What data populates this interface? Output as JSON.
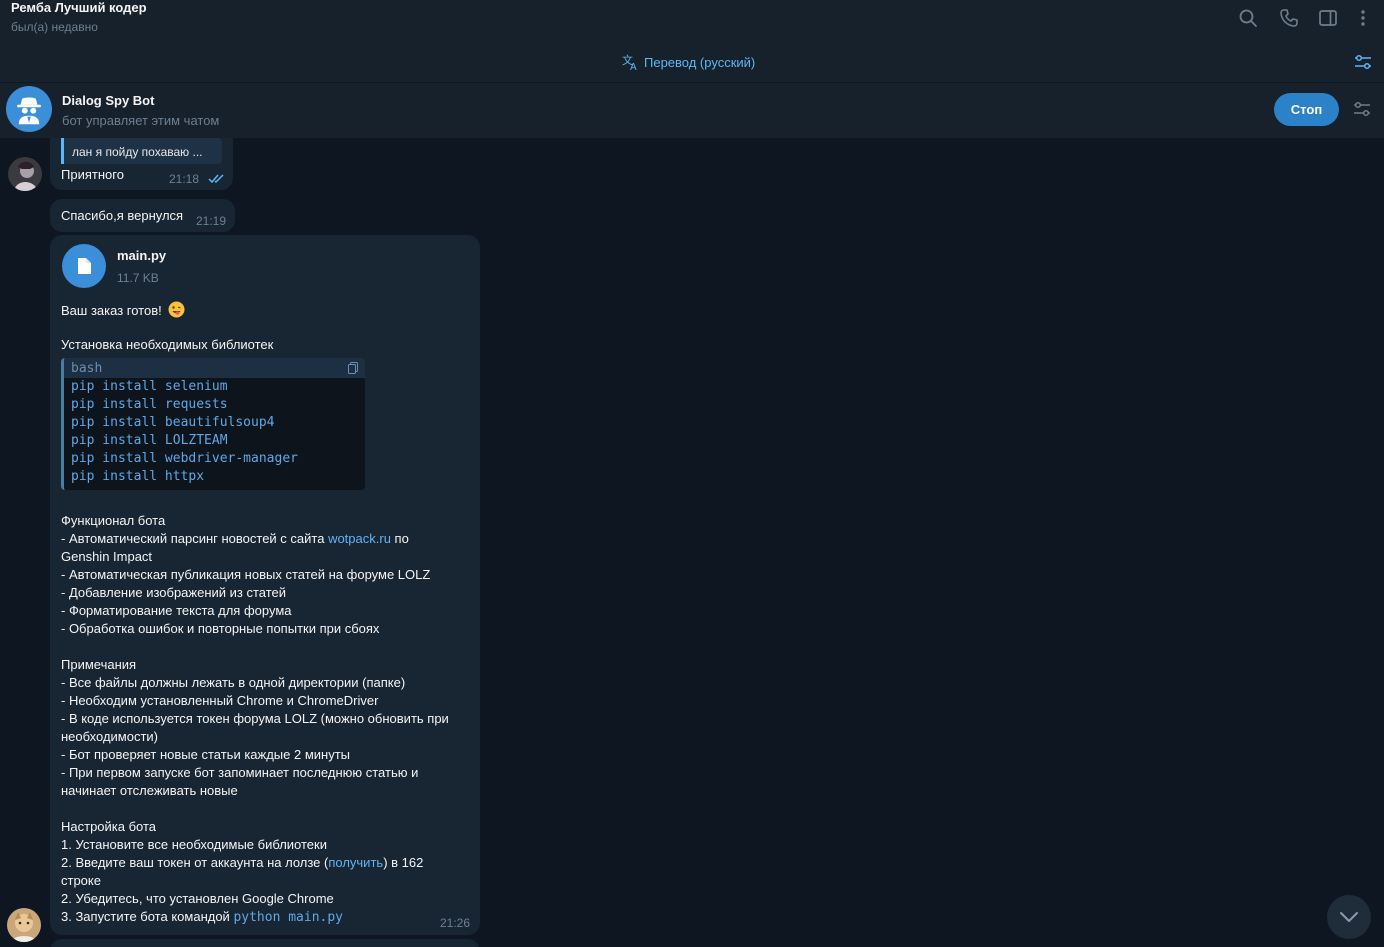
{
  "header": {
    "title": "Ремба Лучший кодер",
    "status": "был(а) недавно",
    "icons": [
      "search-icon",
      "phone-icon",
      "sidebar-icon",
      "more-icon"
    ]
  },
  "translate": {
    "label": "Перевод (русский)",
    "icon": "translate-icon"
  },
  "bot": {
    "name": "Dialog Spy Bot",
    "subtitle": "бот управляет этим чатом",
    "stop_label": "Стоп"
  },
  "messages": {
    "m1": {
      "reply_text": "лан я пойду похаваю ...",
      "text": "Приятного",
      "time": "21:18"
    },
    "m2": {
      "text": "Спасибо,я вернулся",
      "time": "21:19"
    },
    "m3": {
      "file_name": "main.py",
      "file_size": "11.7 KB",
      "ready": "Ваш заказ готов!",
      "install_heading": "Установка необходимых библиотек",
      "code_lang": "bash",
      "code_lines": [
        "pip install selenium",
        "pip install requests",
        "pip install beautifulsoup4",
        "pip install LOLZTEAM",
        "pip install webdriver-manager",
        "pip install httpx"
      ],
      "func_heading": "Функционал бота",
      "func_1a": "- Автоматический парсинг новостей с сайта ",
      "func_1_link": "wotpack.ru",
      "func_1b": " по",
      "func_1c": "Genshin Impact",
      "func_2": "- Автоматическая публикация новых статей на форуме LOLZ",
      "func_3": "- Добавление изображений из статей",
      "func_4": "- Форматирование текста для форума",
      "func_5": "- Обработка ошибок и повторные попытки при сбоях",
      "notes_heading": "Примечания",
      "note_1": "- Все файлы должны лежать в одной директории (папке)",
      "note_2": "- Необходим установленный Chrome и ChromeDriver",
      "note_3a": "- В коде используется токен форума LOLZ (можно обновить при",
      "note_3b": "необходимости)",
      "note_4": "- Бот проверяет новые статьи каждые 2 минуты",
      "note_5a": "- При первом запуске бот запоминает последнюю статью и",
      "note_5b": "начинает отслеживать новые",
      "setup_heading": "Настройка бота",
      "setup_1": "1. Установите все необходимые библиотеки",
      "setup_2a": "2. Введите ваш токен от аккаунта на лолзе (",
      "setup_2_link": "получить",
      "setup_2b": ") в 162",
      "setup_2c": "строке",
      "setup_3": "2. Убедитесь, что установлен Google Chrome",
      "setup_4a": "3. Запустите бота командой ",
      "setup_4_code": "python main.py",
      "time": "21:26"
    }
  },
  "colors": {
    "background": "#0e1621",
    "panel": "#17212b",
    "bubble": "#182533",
    "accent": "#5eb5f7",
    "stop_button": "#2b82c9"
  }
}
